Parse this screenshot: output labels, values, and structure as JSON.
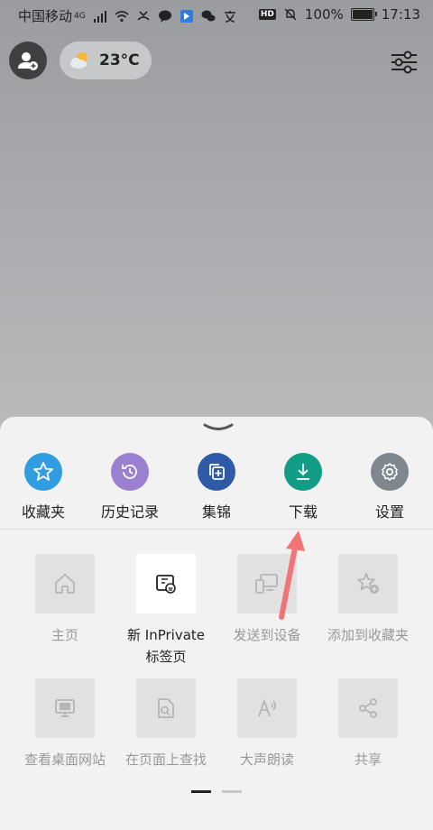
{
  "status_bar": {
    "carrier": "中国移动",
    "network": "4G",
    "battery": "100%",
    "time": "17:13",
    "hd_badge": "HD"
  },
  "header": {
    "weather_temp": "23°C"
  },
  "quick_actions": [
    {
      "label": "收藏夹",
      "icon": "star-icon",
      "color": "#2f9de0"
    },
    {
      "label": "历史记录",
      "icon": "history-icon",
      "color": "#9b7fd1"
    },
    {
      "label": "集锦",
      "icon": "collections-icon",
      "color": "#2e5aa8"
    },
    {
      "label": "下载",
      "icon": "download-icon",
      "color": "#129e86"
    },
    {
      "label": "设置",
      "icon": "gear-icon",
      "color": "#7f878f"
    }
  ],
  "menu_tiles": [
    {
      "label": "主页",
      "icon": "home-icon",
      "enabled": false
    },
    {
      "label": "新 InPrivate\n标签页",
      "icon": "inprivate-icon",
      "enabled": true
    },
    {
      "label": "发送到设备",
      "icon": "send-device-icon",
      "enabled": false
    },
    {
      "label": "添加到收藏夹",
      "icon": "add-favorite-icon",
      "enabled": false
    },
    {
      "label": "查看桌面网站",
      "icon": "desktop-site-icon",
      "enabled": false
    },
    {
      "label": "在页面上查找",
      "icon": "find-in-page-icon",
      "enabled": false
    },
    {
      "label": "大声朗读",
      "icon": "read-aloud-icon",
      "enabled": false
    },
    {
      "label": "共享",
      "icon": "share-icon",
      "enabled": false
    }
  ],
  "annotation_color": "#f07578"
}
